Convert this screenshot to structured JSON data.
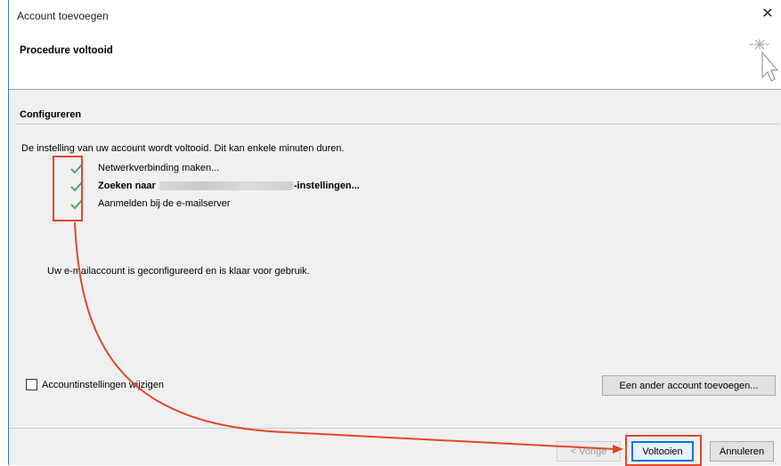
{
  "window": {
    "title": "Account toevoegen",
    "close_glyph": "✕"
  },
  "header": {
    "title": "Procedure voltooid",
    "icon": "wizard-cursor-sparkle-icon"
  },
  "section": {
    "title": "Configureren",
    "description": "De instelling van uw account wordt voltooid. Dit kan enkele minuten duren.",
    "steps": [
      {
        "label": "Netwerkverbinding maken...",
        "status": "done"
      },
      {
        "label_prefix": "Zoeken naar",
        "label_suffix": "-instellingen...",
        "status": "done",
        "bold": true
      },
      {
        "label": "Aanmelden bij de e-mailserver",
        "status": "done"
      }
    ],
    "result_message": "Uw e-mailaccount is geconfigureerd en is klaar voor gebruik."
  },
  "options": {
    "change_settings_label": "Accountinstellingen wijzigen",
    "change_settings_checked": false,
    "add_another_label": "Een ander account toevoegen..."
  },
  "footer": {
    "back_label": "< Vorige",
    "finish_label": "Voltooien",
    "cancel_label": "Annuleren"
  },
  "colors": {
    "annotation": "#e0482a",
    "check": "#5aa069",
    "focus": "#0078d7"
  }
}
